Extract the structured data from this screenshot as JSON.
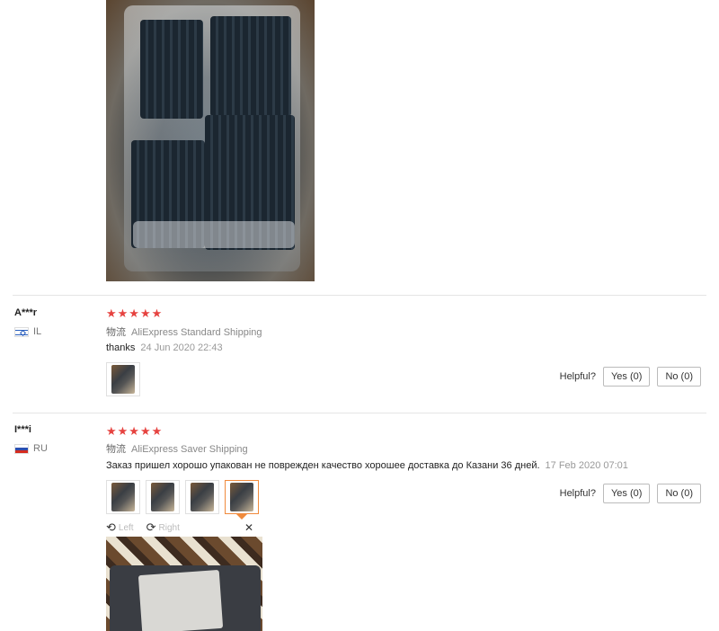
{
  "reviews": [
    {
      "user": "A***r",
      "country": "IL",
      "flag_icon": "israel-flag-icon",
      "stars": "★★★★★",
      "rating": 5,
      "shipping_label": "物流",
      "shipping": "AliExpress Standard Shipping",
      "comment": "thanks",
      "date": "24 Jun 2020 22:43",
      "photo_count": 1,
      "helpful_label": "Helpful?",
      "yes_label": "Yes (0)",
      "no_label": "No (0)"
    },
    {
      "user": "I***i",
      "country": "RU",
      "flag_icon": "russia-flag-icon",
      "stars": "★★★★★",
      "rating": 5,
      "shipping_label": "物流",
      "shipping": "AliExpress Saver Shipping",
      "comment": "Заказ пришел хорошо упакован не поврежден качество хорошее доставка до Казани 36 дней.",
      "date": "17 Feb 2020 07:01",
      "photo_count": 4,
      "helpful_label": "Helpful?",
      "yes_label": "Yes (0)",
      "no_label": "No (0)"
    }
  ],
  "viewer": {
    "left_label": "Left",
    "right_label": "Right",
    "close_icon": "close-icon",
    "rotate_left_icon": "rotate-left-icon",
    "rotate_right_icon": "rotate-right-icon"
  },
  "colors": {
    "star": "#e64340",
    "active_thumb_border": "#f08a3c"
  }
}
